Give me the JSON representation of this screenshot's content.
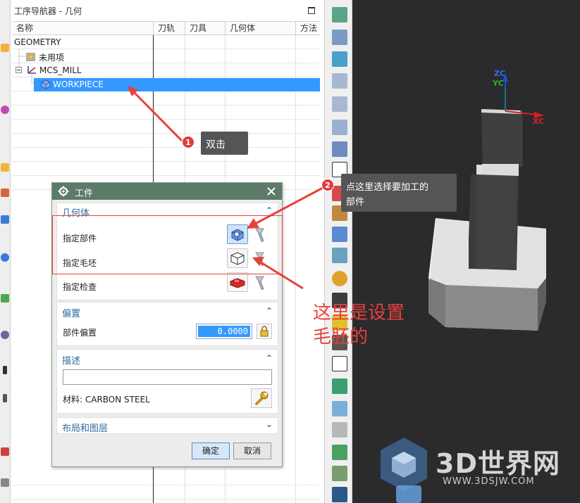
{
  "navigator": {
    "title": "工序导航器 - 几何",
    "columns": [
      "名称",
      "刀轨",
      "刀具",
      "几何体",
      "方法"
    ],
    "tree": {
      "root": "GEOMETRY",
      "unused": "未用项",
      "mcs": "MCS_MILL",
      "workpiece": "WORKPIECE"
    }
  },
  "dialog": {
    "title": "工件",
    "geometry_section": "几何体",
    "specify_part": "指定部件",
    "specify_blank": "指定毛坯",
    "specify_check": "指定检查",
    "offset_section": "偏置",
    "part_offset_label": "部件偏置",
    "part_offset_value": "0.0000",
    "description_section": "描述",
    "description_value": "",
    "material_label": "材料: CARBON STEEL",
    "layout_section": "布局和图层",
    "ok": "确定",
    "cancel": "取消"
  },
  "annotations": {
    "step1_badge": "1",
    "step1_text": "双击",
    "step2_badge": "2",
    "step2_text_line1": "点这里选择要加工的",
    "step2_text_line2": "部件",
    "blank_note_line1": "这里是设置",
    "blank_note_line2": "毛胚的"
  },
  "viewport": {
    "axis_zc": "ZC",
    "axis_yc": "YC",
    "axis_xc": "XC",
    "watermark_brand": "3D世界网",
    "watermark_url": "WWW.3DSJW.COM"
  },
  "colors": {
    "selection": "#3399ff",
    "dialog_titlebar": "#5c7b6b",
    "annotation_red": "#e8413a",
    "viewport_bg": "#2b2b2e"
  }
}
